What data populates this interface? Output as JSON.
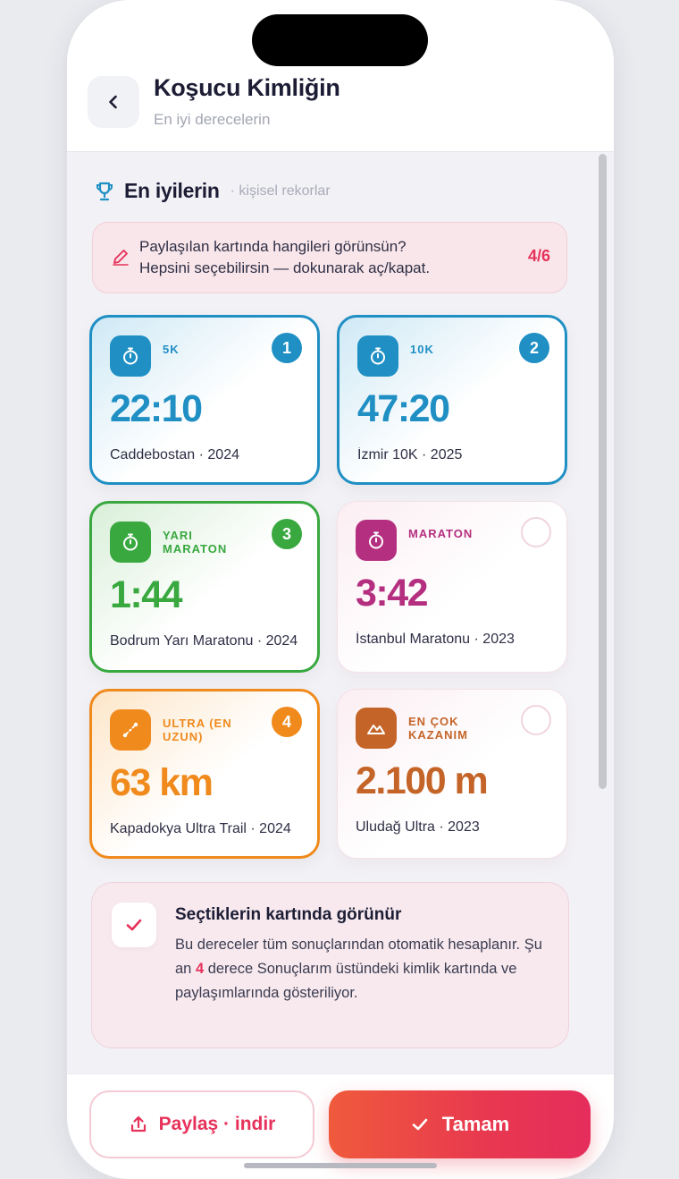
{
  "header": {
    "title": "Koşucu Kimliğin",
    "subtitle": "En iyi derecelerin",
    "back_icon": "chevron-left-icon"
  },
  "section": {
    "title": "En iyilerin",
    "subtitle": "· kişisel rekorlar",
    "icon": "trophy-icon"
  },
  "hint": {
    "line1": "Paylaşılan kartında hangileri görünsün?",
    "line2": "Hepsini seçebilirsin — dokunarak aç/kapat.",
    "count": "4/6",
    "icon": "pencil-icon"
  },
  "records": [
    {
      "label": "5K",
      "value": "22:10",
      "caption": "Caddebostan · 2024",
      "selected": true,
      "order": "1",
      "color": "#1f8fc4",
      "icon": "stopwatch-icon"
    },
    {
      "label": "10K",
      "value": "47:20",
      "caption": "İzmir 10K · 2025",
      "selected": true,
      "order": "2",
      "color": "#1f8fc4",
      "icon": "stopwatch-icon"
    },
    {
      "label": "Yarı Maraton",
      "value": "1:44",
      "caption": "Bodrum Yarı Maratonu · 2024",
      "selected": true,
      "order": "3",
      "color": "#38a83f",
      "icon": "stopwatch-icon"
    },
    {
      "label": "Maraton",
      "value": "3:42",
      "caption": "İstanbul Maratonu · 2023",
      "selected": false,
      "order": "",
      "color": "#b42f7f",
      "icon": "stopwatch-icon"
    },
    {
      "label": "Ultra (en uzun)",
      "value": "63 km",
      "caption": "Kapadokya Ultra Trail · 2024",
      "selected": true,
      "order": "4",
      "color": "#f08a1c",
      "icon": "route-icon"
    },
    {
      "label": "En çok kazanım",
      "value": "2.100 m",
      "caption": "Uludağ Ultra · 2023",
      "selected": false,
      "order": "",
      "color": "#c46428",
      "icon": "mountain-icon"
    }
  ],
  "info": {
    "title": "Seçtiklerin kartında görünür",
    "body_1": "Bu dereceler tüm sonuçlarından otomatik hesaplanır. Şu an ",
    "count": "4",
    "body_2": " derece Sonuçlarım üstündeki kimlik kartında ve paylaşımlarında gösteriliyor.",
    "checked": true
  },
  "actions": {
    "share_label": "Paylaş · indir",
    "done_label": "Tamam"
  }
}
